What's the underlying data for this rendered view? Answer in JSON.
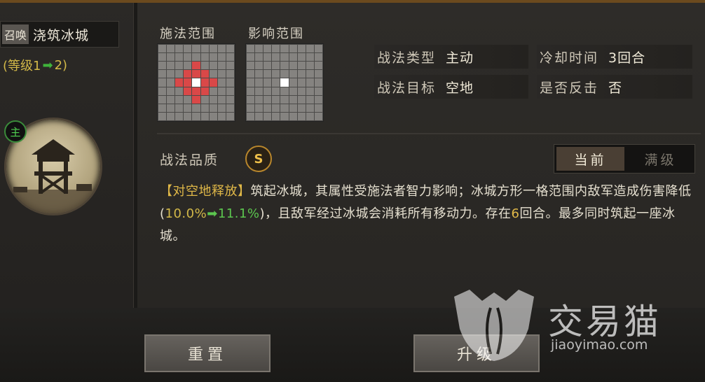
{
  "skill": {
    "summon_tag": "召唤",
    "name": "浇筑冰城",
    "level_prefix": "(等级1",
    "level_arrow": "➡",
    "level_suffix": "2)",
    "main_badge": "主"
  },
  "ranges": {
    "cast_title": "施法范围",
    "effect_title": "影响范围"
  },
  "info": {
    "type_label": "战法类型",
    "type_value": "主动",
    "cooldown_label": "冷却时间",
    "cooldown_value": "3回合",
    "target_label": "战法目标",
    "target_value": "空地",
    "counter_label": "是否反击",
    "counter_value": "否"
  },
  "quality": {
    "label": "战法品质",
    "grade": "S"
  },
  "toggle": {
    "current": "当前",
    "max": "满级"
  },
  "description": {
    "tag": "【对空地释放】",
    "part1": "筑起冰城，其属性受施法者智力影响；冰城方形一格范围内敌军造成伤害降低(",
    "value_old": "10.0%",
    "arrow": "➡",
    "value_new": "11.1%",
    "part2": ")，且敌军经过冰城会消耗所有移动力。存在",
    "turns": "6",
    "part3": "回合。最多同时筑起一座冰城。"
  },
  "buttons": {
    "reset": "重置",
    "upgrade": "升级"
  },
  "watermark": {
    "name": "交易猫",
    "url": "jiaoyimao.com"
  },
  "colors": {
    "gold": "#e0b848",
    "green": "#5cc64f",
    "range_red": "#d94848",
    "grid_cell": "#858380"
  },
  "icons": {
    "emblem": "watchtower-icon",
    "quality": "s-grade-badge-icon",
    "arrow": "right-arrow-icon",
    "watermark": "cat-logo-icon"
  }
}
